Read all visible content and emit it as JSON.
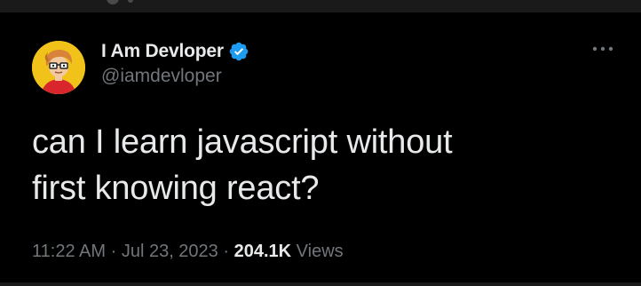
{
  "tweet": {
    "author": {
      "display_name": "I Am Devloper",
      "handle": "@iamdevloper",
      "verified": true,
      "avatar_icon": "cartoon-avatar-icon"
    },
    "text_lines": [
      "can I learn javascript without",
      "first knowing react?"
    ],
    "time": "11:22 AM",
    "separator": "·",
    "date": "Jul 23, 2023",
    "views_count": "204.1K",
    "views_label": "Views"
  },
  "icons": {
    "more": "more-options-icon",
    "verified": "verified-badge-icon"
  },
  "colors": {
    "background": "#000000",
    "text_primary": "#e7e9ea",
    "text_secondary": "#71767b",
    "verified_blue": "#1d9bf0",
    "avatar_bg": "#f0c21a"
  }
}
